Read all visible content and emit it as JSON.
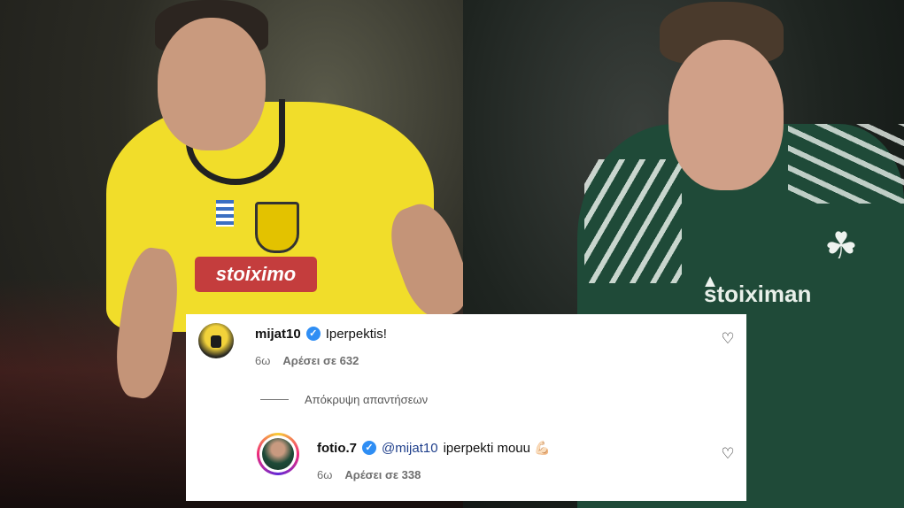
{
  "background": {
    "left_photo": {
      "sponsor_text": "stoiximo"
    },
    "right_photo": {
      "sponsor_text": "stoiximan"
    }
  },
  "comment": {
    "username": "mijat10",
    "verified": true,
    "text": "Iperpektis!",
    "time": "6ω",
    "likes": "Αρέσει σε 632",
    "hide_replies": "Απόκρυψη απαντήσεων"
  },
  "reply": {
    "username": "fotio.7",
    "verified": true,
    "mention": "@mijat10",
    "text": " iperpekti mouu 💪🏻",
    "time": "6ω",
    "likes": "Αρέσει σε 338"
  },
  "colors": {
    "verified_blue": "#2f8ef4",
    "mention_blue": "#1f3f8b",
    "aek_yellow": "#f1dd2a",
    "pao_green": "#1f4a38"
  }
}
